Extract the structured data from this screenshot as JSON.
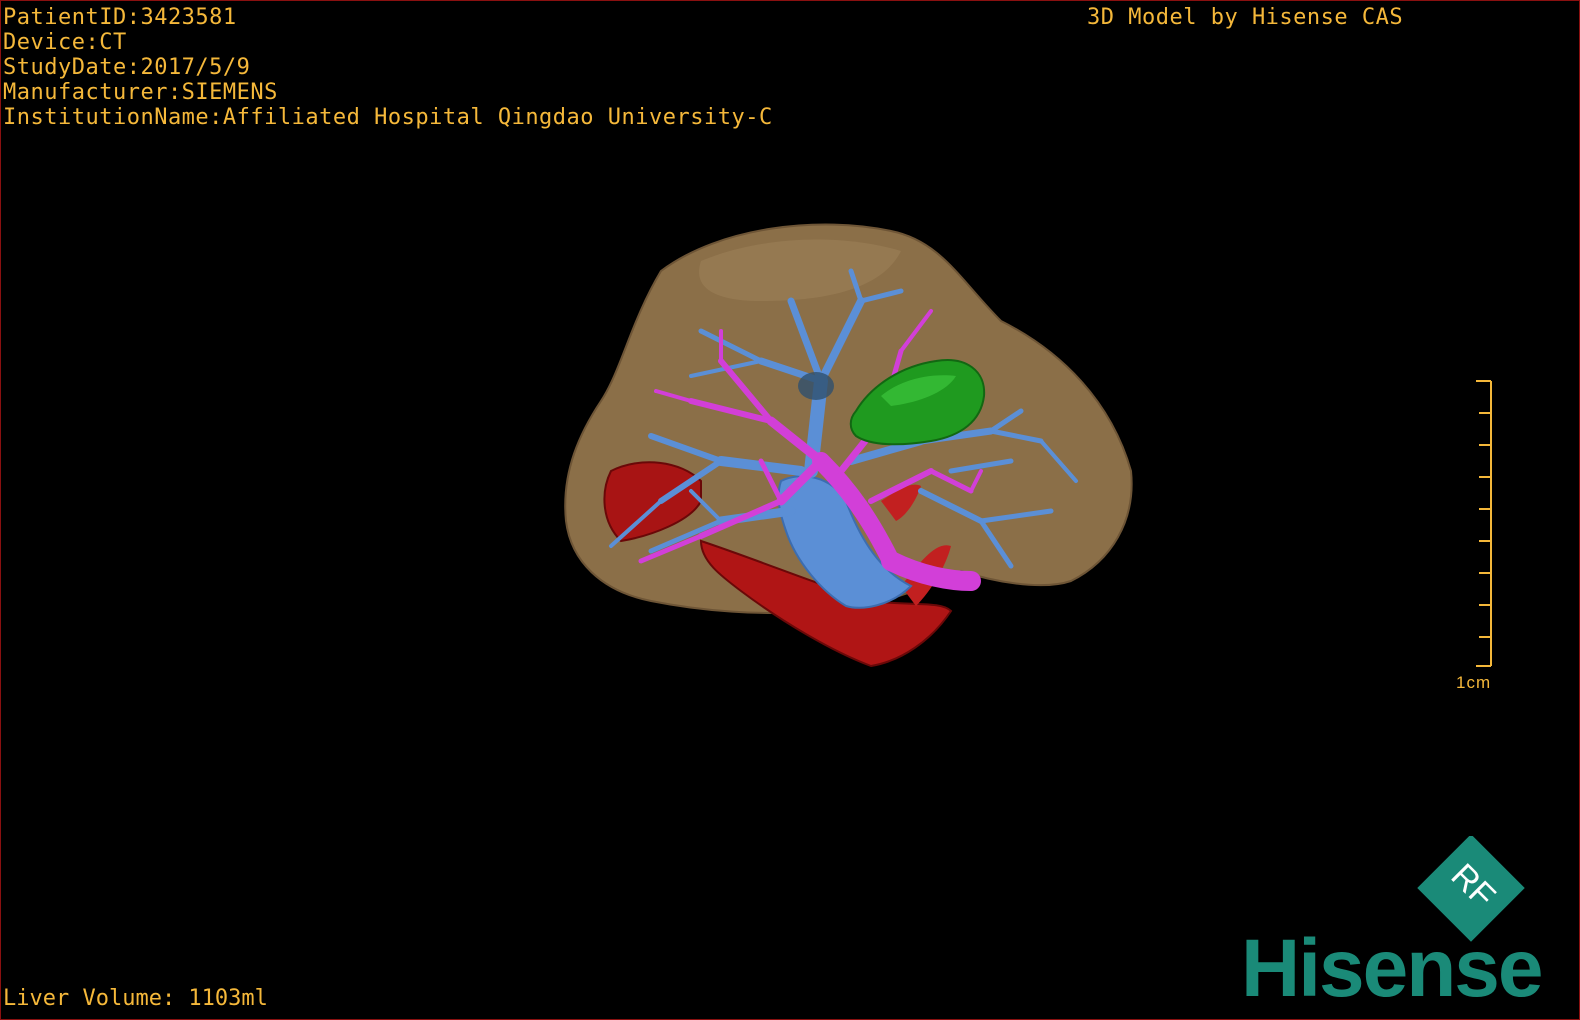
{
  "header": {
    "patient_id": "PatientID:3423581",
    "device": "Device:CT",
    "study_date": "StudyDate:2017/5/9",
    "manufacturer": "Manufacturer:SIEMENS",
    "institution": "InstitutionName:Affiliated Hospital Qingdao University-C"
  },
  "watermark_title": "3D Model by Hisense CAS",
  "footer": {
    "liver_volume": "Liver Volume: 1103ml"
  },
  "scale": {
    "label": "1cm"
  },
  "logo": {
    "badge": "RF",
    "brand": "Hisense"
  },
  "colors": {
    "text": "#f5b83a",
    "liver": "#8b6f48",
    "portal_vein": "#5b8fd6",
    "hepatic_vein": "#d23fd8",
    "artery": "#b01515",
    "tumor": "#1f9a1f",
    "brand": "#1a8a78"
  }
}
